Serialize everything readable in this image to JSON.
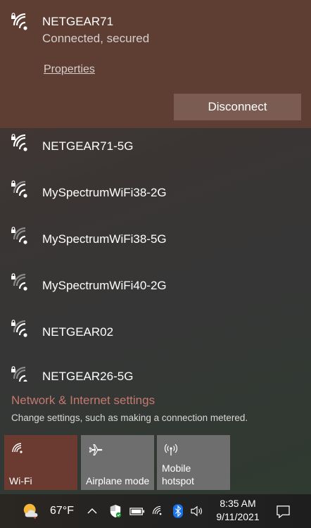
{
  "connected_network": {
    "ssid": "NETGEAR71",
    "status": "Connected, secured",
    "properties_label": "Properties",
    "disconnect_label": "Disconnect"
  },
  "networks": [
    {
      "ssid": "NETGEAR71-5G",
      "secured": true
    },
    {
      "ssid": "MySpectrumWiFi38-2G",
      "secured": true
    },
    {
      "ssid": "MySpectrumWiFi38-5G",
      "secured": true
    },
    {
      "ssid": "MySpectrumWiFi40-2G",
      "secured": true
    },
    {
      "ssid": "NETGEAR02",
      "secured": true
    },
    {
      "ssid": "NETGEAR26-5G",
      "secured": true
    }
  ],
  "settings": {
    "link_label": "Network & Internet settings",
    "description": "Change settings, such as making a connection metered."
  },
  "quick_actions": [
    {
      "label": "Wi-Fi",
      "icon": "wifi-icon",
      "active": true
    },
    {
      "label": "Airplane mode",
      "icon": "airplane-icon",
      "active": false
    },
    {
      "label": "Mobile\nhotspot",
      "icon": "hotspot-icon",
      "active": false
    }
  ],
  "taskbar": {
    "weather_temp": "67°F",
    "weather_icon": "partly-sunny-icon",
    "time": "8:35 AM",
    "date": "9/11/2021"
  },
  "colors": {
    "accent": "#6b3a30",
    "connected_bg": "#5e3d33",
    "disconnect_bg": "#7a5c53",
    "settings_link": "#c5796f"
  }
}
